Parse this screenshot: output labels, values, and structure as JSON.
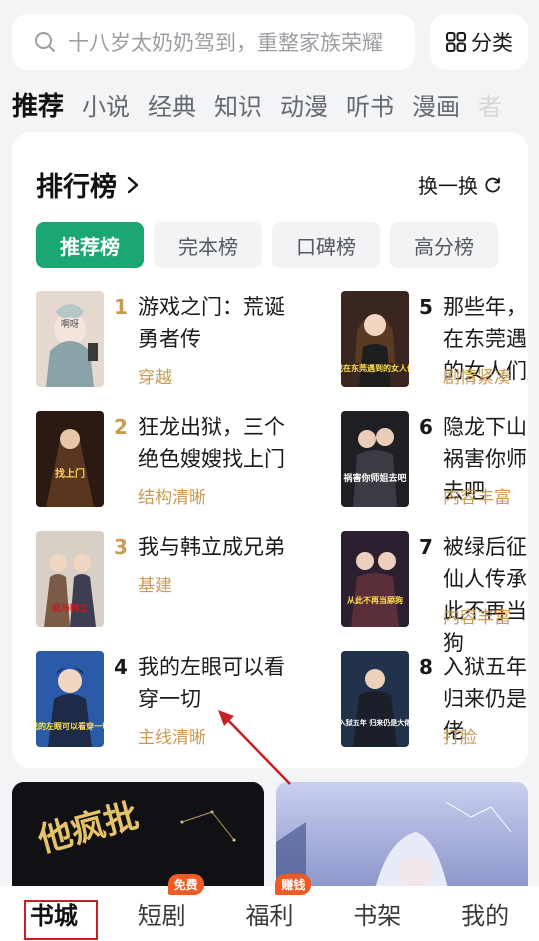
{
  "search": {
    "placeholder": "十八岁太奶奶驾到，重整家族荣耀"
  },
  "category_button": {
    "label": "分类"
  },
  "tabs": [
    {
      "label": "推荐",
      "active": true
    },
    {
      "label": "小说"
    },
    {
      "label": "经典"
    },
    {
      "label": "知识"
    },
    {
      "label": "动漫"
    },
    {
      "label": "听书"
    },
    {
      "label": "漫画"
    },
    {
      "label": "者"
    }
  ],
  "ranking": {
    "title": "排行榜",
    "refresh_label": "换一换",
    "chips": [
      "推荐榜",
      "完本榜",
      "口碑榜",
      "高分榜"
    ],
    "left": [
      {
        "rank": "1",
        "title": "游戏之门：荒诞勇者传",
        "tag": "穿越",
        "cover_text": "啊呀"
      },
      {
        "rank": "2",
        "title": "狂龙出狱，三个绝色嫂嫂找上门",
        "tag": "结构清晰",
        "cover_text": "找上门"
      },
      {
        "rank": "3",
        "title": "我与韩立成兄弟",
        "tag": "基建",
        "cover_text": "我与韩立"
      },
      {
        "rank": "4",
        "title": "我的左眼可以看穿一切",
        "tag": "主线清晰",
        "cover_text": "我的左眼可以看穿一切"
      }
    ],
    "right": [
      {
        "rank": "5",
        "title": "那些年，我在东莞遇到的女人们",
        "tag": "剧情紧凑",
        "cover_text": "我在东莞遇到的女人们"
      },
      {
        "rank": "6",
        "title": "隐龙下山，祸害你师姐去吧",
        "tag": "内容丰富",
        "cover_text": "祸害你师姐去吧"
      },
      {
        "rank": "7",
        "title": "被绿后征服仙人传承 从此不再当舔狗",
        "tag": "内容丰富",
        "cover_text": "从此不再当舔狗"
      },
      {
        "rank": "8",
        "title": "入狱五年，归来仍是大佬",
        "tag": "打脸",
        "cover_text": "入狱五年 归来仍是大佬"
      }
    ]
  },
  "banners": [
    {
      "text": "他疯批"
    },
    {
      "text": ""
    }
  ],
  "bottom_nav": [
    {
      "label": "书城",
      "active": true
    },
    {
      "label": "短剧",
      "badge": "免费"
    },
    {
      "label": "福利",
      "badge": "赚钱"
    },
    {
      "label": "书架"
    },
    {
      "label": "我的"
    }
  ],
  "colors": {
    "accent": "#1ba672",
    "tag": "#c99a52",
    "badge": "#f05a23"
  }
}
